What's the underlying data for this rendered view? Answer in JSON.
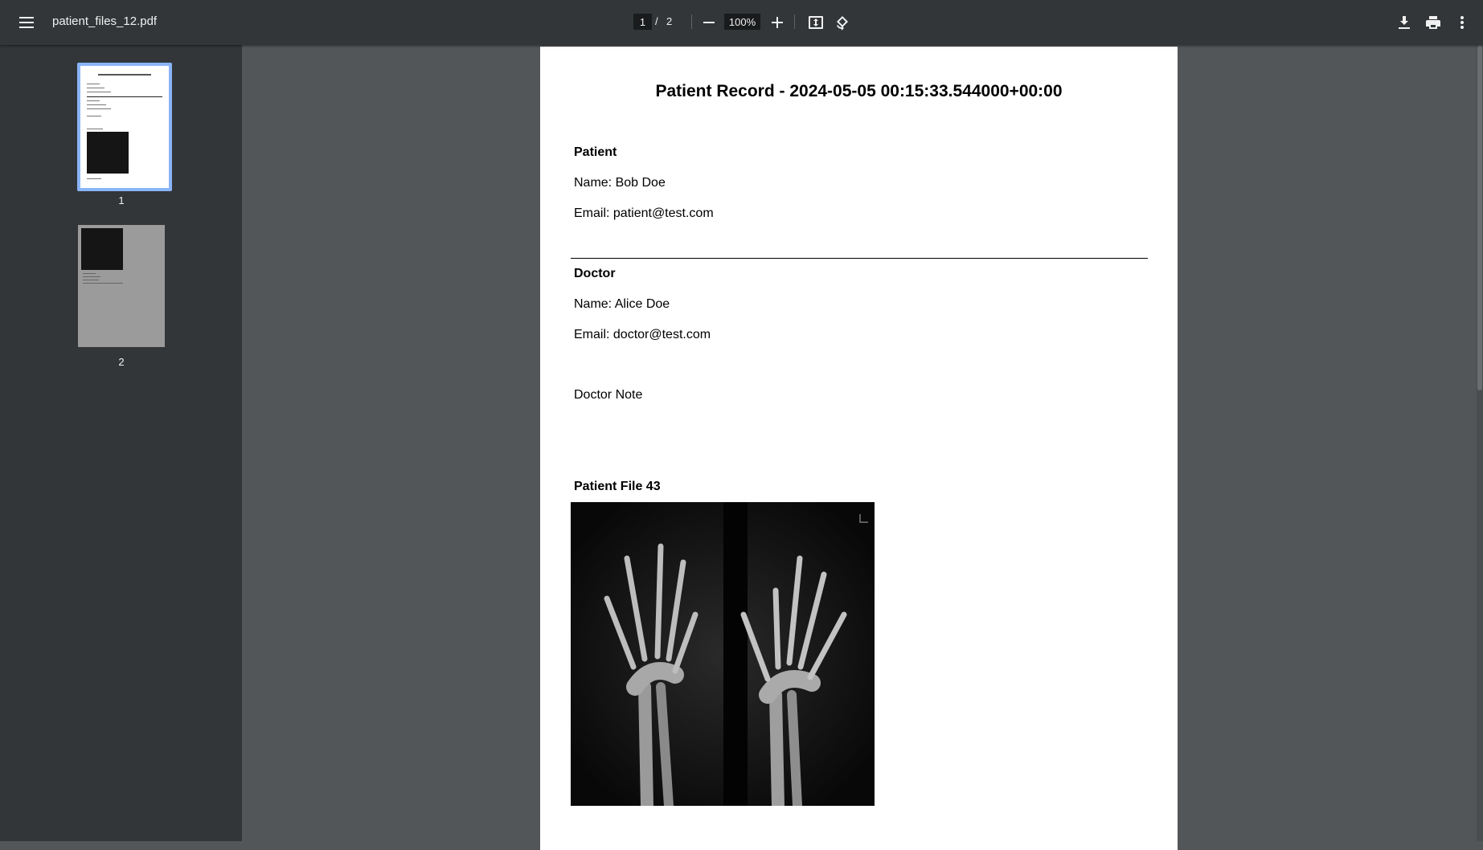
{
  "toolbar": {
    "file_name": "patient_files_12.pdf",
    "current_page": "1",
    "page_separator": "/",
    "total_pages": "2",
    "zoom": "100%"
  },
  "sidebar": {
    "thumbnails": [
      {
        "page_number": "1",
        "selected": true
      },
      {
        "page_number": "2",
        "selected": false
      }
    ]
  },
  "document": {
    "title": "Patient Record - 2024-05-05 00:15:33.544000+00:00",
    "patient_heading": "Patient",
    "patient_name": "Name: Bob Doe",
    "patient_email": "Email: patient@test.com",
    "doctor_heading": "Doctor",
    "doctor_name": "Name: Alice Doe",
    "doctor_email": "Email: doctor@test.com",
    "doctor_note": "Doctor Note",
    "file_heading": "Patient File 43"
  },
  "colors": {
    "toolbar_bg": "#323639",
    "viewer_bg": "#525659",
    "selected_thumb_border": "#8ab4f8"
  },
  "icons": [
    "menu-icon",
    "zoom-out-icon",
    "zoom-in-icon",
    "fit-page-icon",
    "rotate-icon",
    "download-icon",
    "print-icon",
    "more-vert-icon"
  ]
}
